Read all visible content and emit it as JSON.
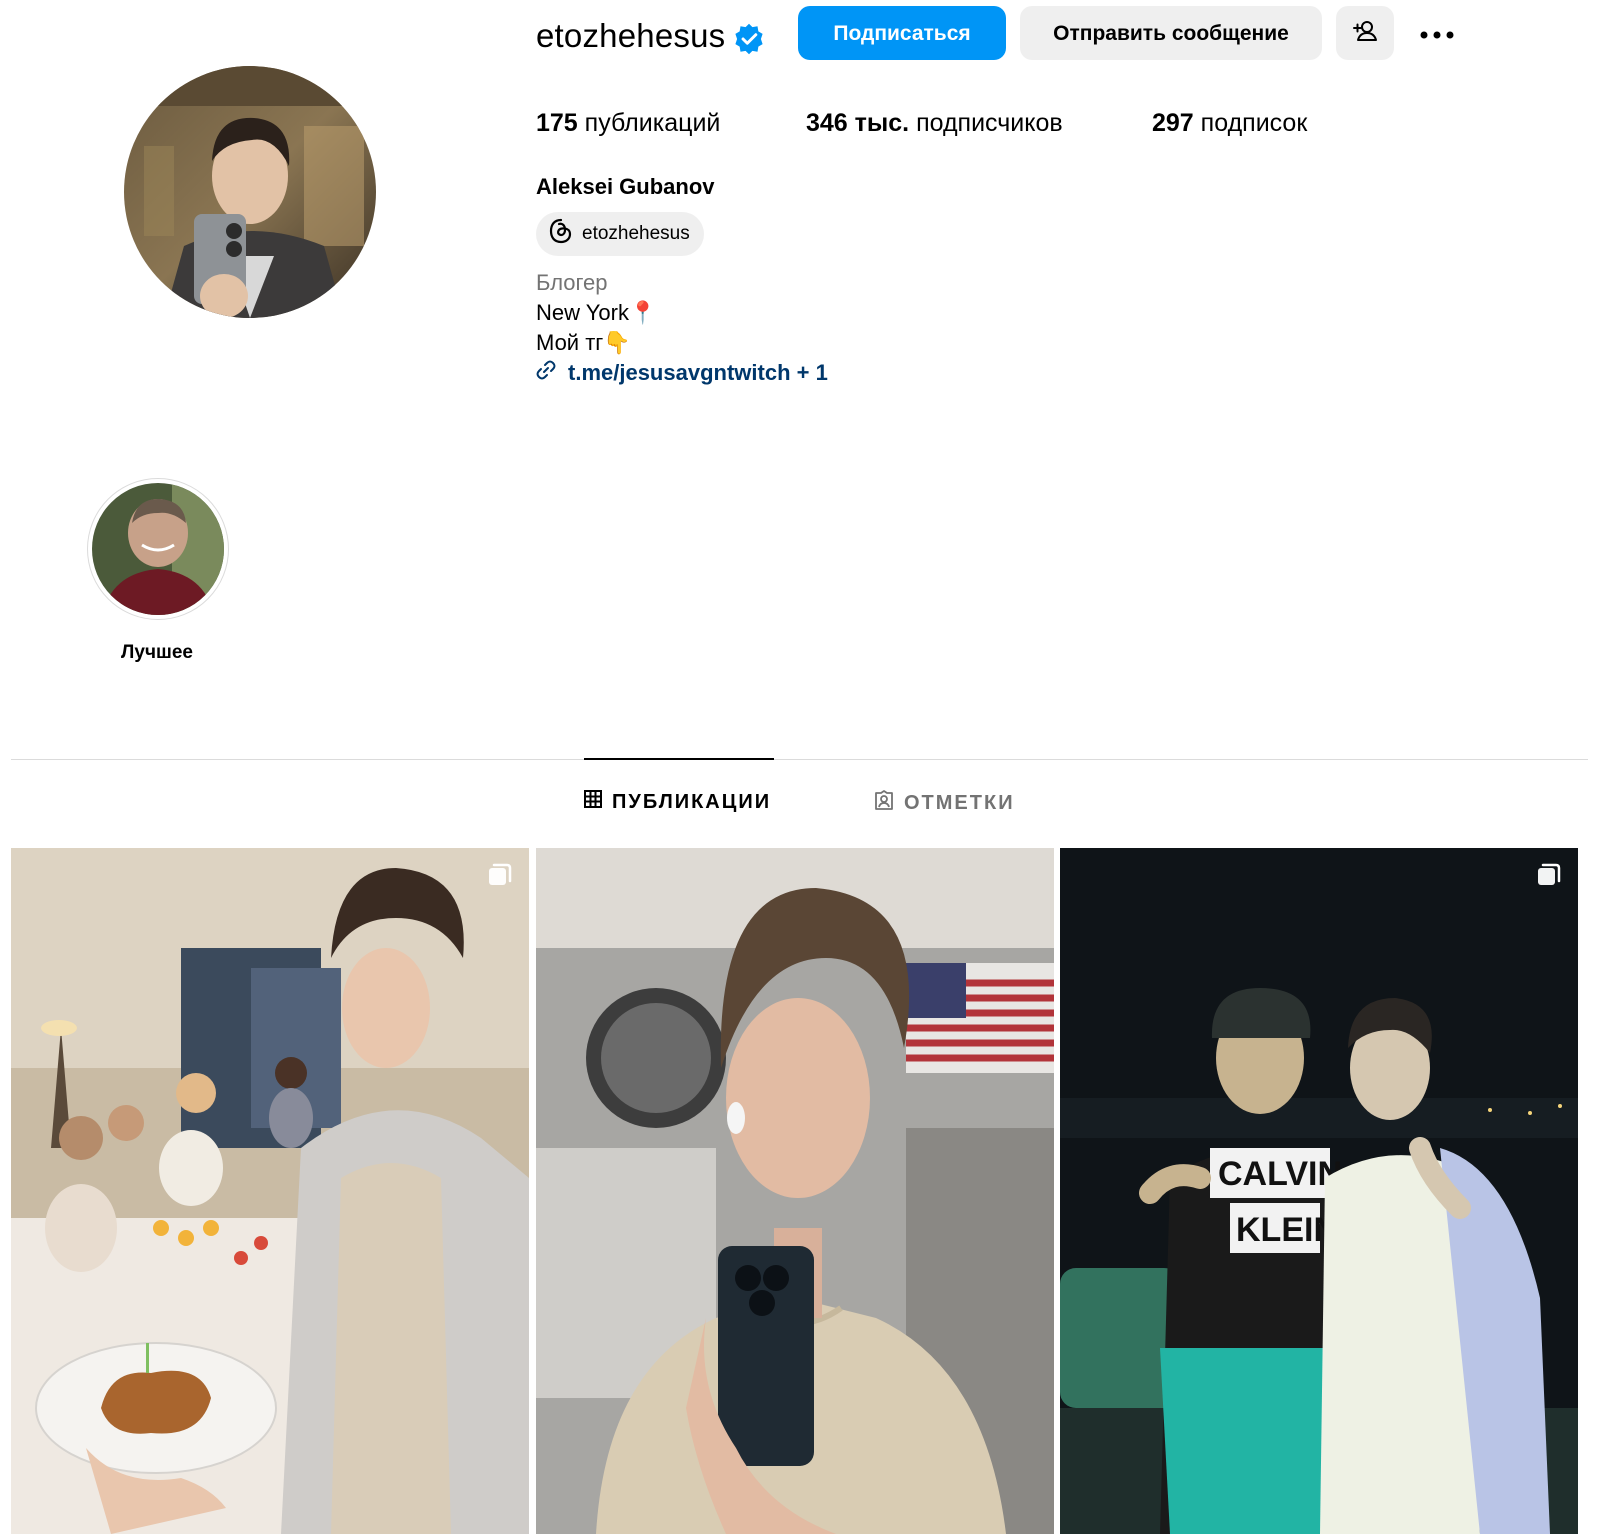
{
  "profile": {
    "username": "etozhehesus",
    "verified": true,
    "follow_label": "Подписаться",
    "message_label": "Отправить сообщение",
    "add_user_icon": "add-user-icon",
    "more_icon": "more-icon",
    "stats": {
      "posts_count": "175",
      "posts_label": "публикаций",
      "followers_count": "346 тыс.",
      "followers_label": "подписчиков",
      "following_count": "297",
      "following_label": "подписок"
    },
    "full_name": "Aleksei Gubanov",
    "threads_handle": "etozhehesus",
    "category": "Блогер",
    "bio_line1": "New York",
    "bio_line1_emoji": "📍",
    "bio_line2": "Мой тг",
    "bio_line2_emoji": "👇",
    "link_text": "t.me/jesusavgntwitch + 1"
  },
  "highlights": [
    {
      "label": "Лучшее"
    }
  ],
  "tabs": {
    "posts": "ПУБЛИКАЦИИ",
    "tagged": "ОТМЕТКИ",
    "active": "posts"
  },
  "colors": {
    "accent": "#0095f6",
    "verified": "#0095f6",
    "link": "#00376b",
    "secondary_text": "#737373",
    "button_bg": "#efefef"
  },
  "posts": [
    {
      "multiple": true
    },
    {
      "multiple": false
    },
    {
      "multiple": true
    }
  ]
}
